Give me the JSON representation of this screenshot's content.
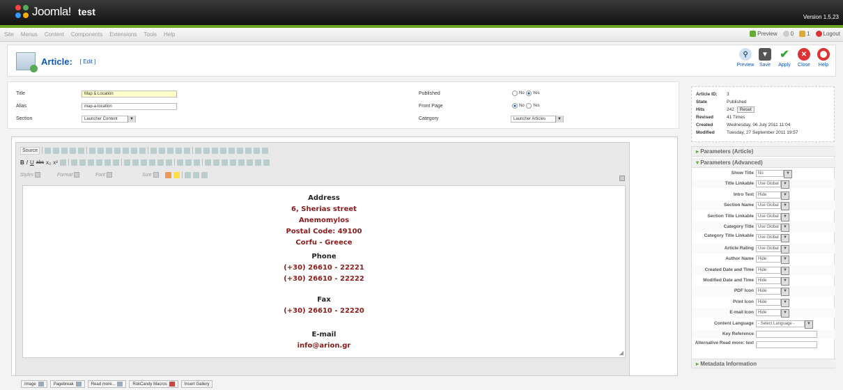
{
  "header": {
    "brand": "Joomla!",
    "site_name": "test",
    "version": "Version 1.5.23"
  },
  "menu": {
    "items": [
      "Site",
      "Menus",
      "Content",
      "Components",
      "Extensions",
      "Tools",
      "Help"
    ],
    "preview": "Preview",
    "messages": "0",
    "users": "1",
    "logout": "Logout"
  },
  "toolbar": {
    "title": "Article:",
    "mode": "[ Edit ]",
    "buttons": {
      "preview": "Preview",
      "save": "Save",
      "apply": "Apply",
      "close": "Close",
      "help": "Help"
    }
  },
  "details": {
    "title_label": "Title",
    "title_value": "Map & Location",
    "alias_label": "Alias",
    "alias_value": "map-a-location",
    "section_label": "Section",
    "section_value": "Launcher Content",
    "published_label": "Published",
    "frontpage_label": "Front Page",
    "category_label": "Category",
    "category_value": "Launcher Articles",
    "no": "No",
    "yes": "Yes"
  },
  "editor": {
    "source": "Source",
    "styles": "Styles",
    "format": "Format",
    "font": "Font",
    "size": "Size",
    "content": {
      "address_h": "Address",
      "addr1": "6, Sherias street",
      "addr2": "Anemomylos",
      "addr3": "Postal Code: 49100",
      "addr4": "Corfu -  Greece",
      "phone_h": "Phone",
      "phone1": "(+30) 26610 - 22221",
      "phone2": "(+30) 26610 - 22222",
      "fax_h": "Fax",
      "fax1": "(+30) 26610 - 22220",
      "email_h": "E-mail",
      "email1": "info@arion.gr"
    },
    "buttons": [
      "Image",
      "Pagebreak",
      "Read more...",
      "RokCandy Macros",
      "Insert Gallery"
    ]
  },
  "info": {
    "id_label": "Article ID:",
    "id": "3",
    "state_label": "State",
    "state": "Published",
    "hits_label": "Hits",
    "hits": "242",
    "reset": "Reset",
    "revised_label": "Revised",
    "revised": "41 Times",
    "created_label": "Created",
    "created": "Wednesday, 06 July 2011 11:04",
    "modified_label": "Modified",
    "modified": "Tuesday, 27 September 2011 19:57"
  },
  "params": {
    "article": "Parameters (Article)",
    "advanced": "Parameters (Advanced)",
    "metadata": "Metadata Information",
    "rows": [
      {
        "label": "Show Title",
        "value": "No"
      },
      {
        "label": "Title Linkable",
        "value": "Use Global"
      },
      {
        "label": "Intro Text",
        "value": "Hide"
      },
      {
        "label": "Section Name",
        "value": "Use Global"
      },
      {
        "label": "Section Title Linkable",
        "value": "Use Global"
      },
      {
        "label": "Category Title",
        "value": "Use Global"
      },
      {
        "label": "Category Title Linkable",
        "value": "Use Global"
      },
      {
        "label": "Article Rating",
        "value": "Use Global"
      },
      {
        "label": "Author Name",
        "value": "Hide"
      },
      {
        "label": "Created Date and Time",
        "value": "Hide"
      },
      {
        "label": "Modified Date and Time",
        "value": "Hide"
      },
      {
        "label": "PDF Icon",
        "value": "Hide"
      },
      {
        "label": "Print Icon",
        "value": "Hide"
      },
      {
        "label": "E-mail Icon",
        "value": "Hide"
      },
      {
        "label": "Content Language",
        "value": "- Select Language -"
      },
      {
        "label": "Key Reference",
        "value": ""
      },
      {
        "label": "Alternative Read more: text",
        "value": ""
      }
    ]
  }
}
